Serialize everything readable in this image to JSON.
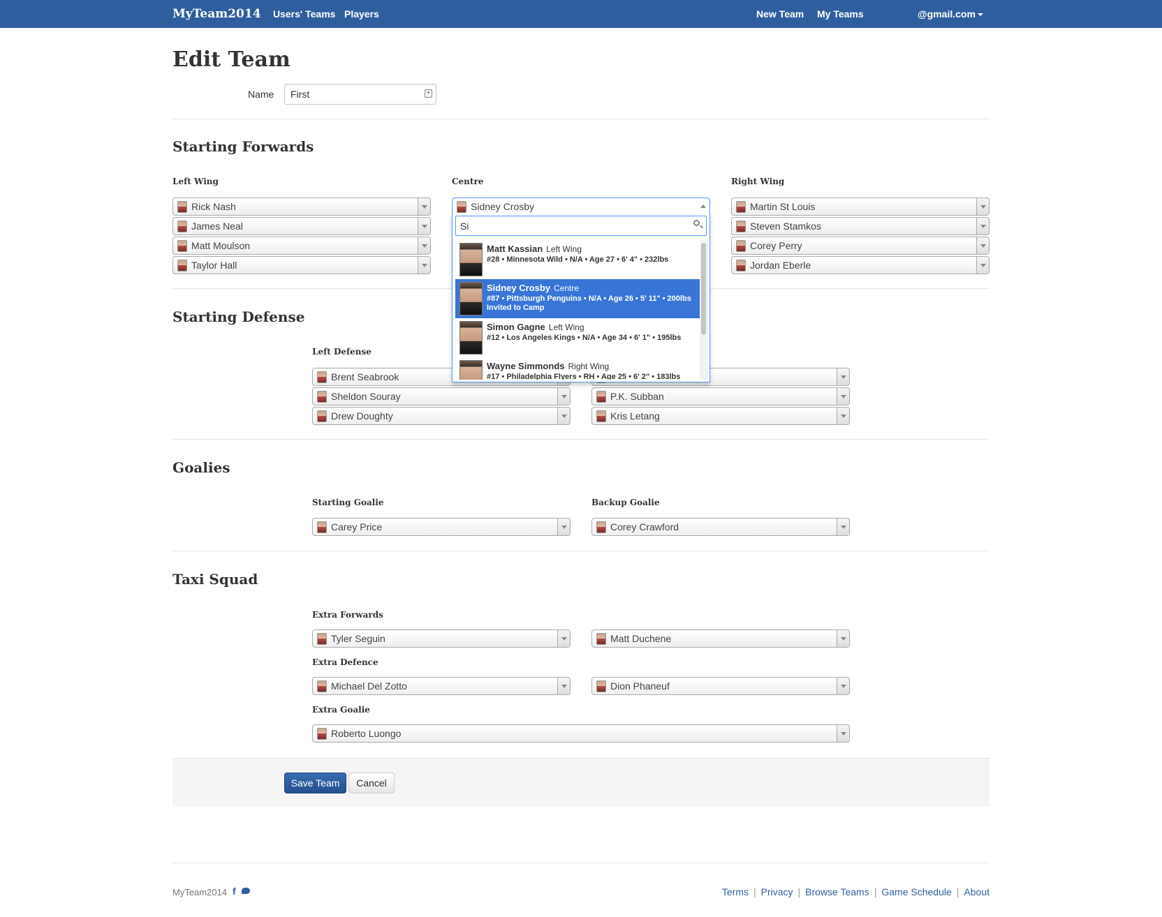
{
  "navbar": {
    "brand": "MyTeam2014",
    "left_links": [
      "Users' Teams",
      "Players"
    ],
    "right_links": [
      "New Team",
      "My Teams"
    ],
    "account": "@gmail.com"
  },
  "page": {
    "title": "Edit Team"
  },
  "name_field": {
    "label": "Name",
    "value": "First"
  },
  "sections": {
    "forwards": "Starting Forwards",
    "defense": "Starting Defense",
    "goalies": "Goalies",
    "taxi": "Taxi Squad"
  },
  "labels": {
    "left_wing": "Left Wing",
    "centre": "Centre",
    "right_wing": "Right Wing",
    "left_defense": "Left Defense",
    "starting_goalie": "Starting Goalie",
    "backup_goalie": "Backup Goalie",
    "extra_forwards": "Extra Forwards",
    "extra_defence": "Extra Defence",
    "extra_goalie": "Extra Goalie"
  },
  "forwards": {
    "left_wing": [
      "Rick Nash",
      "James Neal",
      "Matt Moulson",
      "Taylor Hall"
    ],
    "centre_selected": "Sidney Crosby",
    "right_wing": [
      "Martin St Louis",
      "Steven Stamkos",
      "Corey Perry",
      "Jordan Eberle"
    ]
  },
  "centre_dropdown": {
    "search_value": "Si",
    "results": [
      {
        "name": "Matt Kassian",
        "position": "Left Wing",
        "info": "#28 • Minnesota Wild • N/A • Age 27 • 6' 4\" • 232lbs",
        "extra": ""
      },
      {
        "name": "Sidney Crosby",
        "position": "Centre",
        "info": "#87 • Pittsburgh Penguins • N/A • Age 26 • 5' 11\" • 200lbs",
        "extra": "Invited to Camp"
      },
      {
        "name": "Simon Gagne",
        "position": "Left Wing",
        "info": "#12 • Los Angeles Kings • N/A • Age 34 • 6' 1\" • 195lbs",
        "extra": ""
      },
      {
        "name": "Wayne Simmonds",
        "position": "Right Wing",
        "info": "#17 • Philadelphia Flyers • RH • Age 25 • 6' 2\" • 183lbs",
        "extra": ""
      }
    ]
  },
  "defense": {
    "left": [
      "Brent Seabrook",
      "Sheldon Souray",
      "Drew Doughty"
    ],
    "right": [
      "",
      "P.K. Subban",
      "Kris Letang"
    ]
  },
  "goalies": {
    "starting": "Carey Price",
    "backup": "Corey Crawford"
  },
  "taxi": {
    "extra_forwards": [
      "Tyler Seguin",
      "Matt Duchene"
    ],
    "extra_defence": [
      "Michael Del Zotto",
      "Dion Phaneuf"
    ],
    "extra_goalie": "Roberto Luongo"
  },
  "actions": {
    "save": "Save Team",
    "cancel": "Cancel"
  },
  "footer": {
    "brand": "MyTeam2014",
    "social_icons": [
      "facebook-icon",
      "twitter-icon"
    ],
    "links": [
      "Terms",
      "Privacy",
      "Browse Teams",
      "Game Schedule",
      "About"
    ]
  }
}
